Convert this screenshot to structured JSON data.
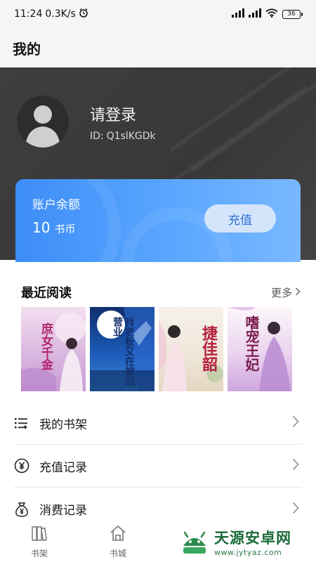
{
  "status_bar": {
    "time": "11:24",
    "speed": "0.3K/s",
    "battery": "36"
  },
  "header": {
    "title": "我的"
  },
  "profile": {
    "name": "请登录",
    "id_label": "ID:",
    "id_value": "Q1slKGDk"
  },
  "balance": {
    "title": "账户余额",
    "amount": "10",
    "unit": "书币",
    "recharge_label": "充值"
  },
  "recent": {
    "title": "最近阅读",
    "more_label": "更多",
    "books": [
      {
        "cover_text": "庶女千金",
        "cover_color": "#e9cfe6"
      },
      {
        "cover_text": "肖老板又在被迫营业",
        "cover_color": "#1f4a9c"
      },
      {
        "cover_text": "捷佳韶",
        "cover_color": "#f2ebe0"
      },
      {
        "cover_text": "嗜宠王妃",
        "cover_color": "#d9b8e8"
      }
    ]
  },
  "menu": [
    {
      "label": "我的书架",
      "icon": "bookshelf-list-icon"
    },
    {
      "label": "充值记录",
      "icon": "yen-circle-icon"
    },
    {
      "label": "消费记录",
      "icon": "yen-bag-icon"
    }
  ],
  "bottom_nav": [
    {
      "label": "书架",
      "icon": "bookshelf-icon"
    },
    {
      "label": "书城",
      "icon": "home-icon"
    }
  ],
  "watermark": {
    "text": "天源安卓网",
    "url": "www.jytyaz.com"
  },
  "colors": {
    "balance_start": "#3d8df7",
    "balance_end": "#79b8ff",
    "recharge_text": "#2e6fd4",
    "profile_bg": "#3e3e3e"
  }
}
